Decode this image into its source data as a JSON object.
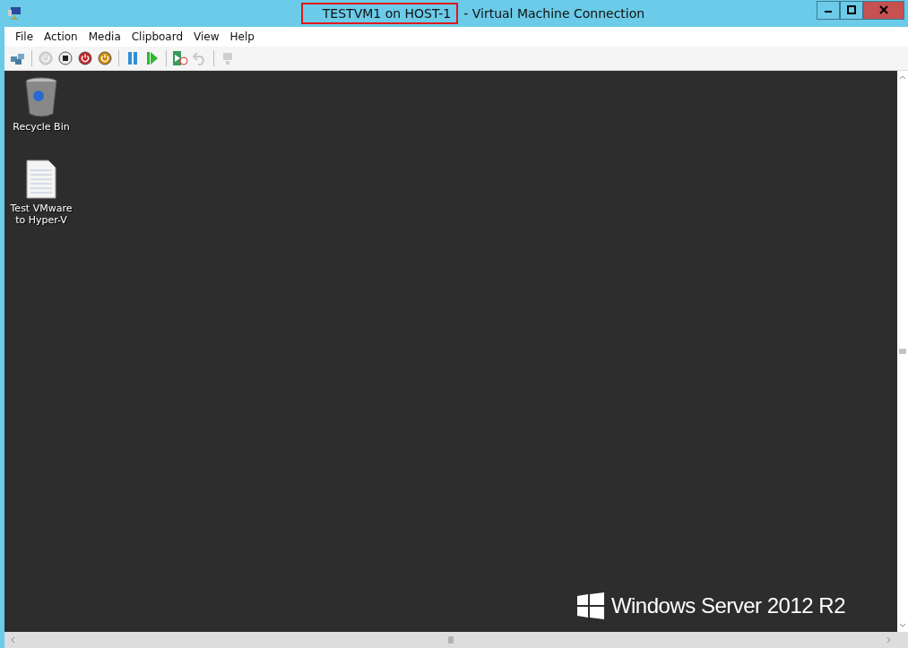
{
  "window": {
    "title_highlighted": "TESTVM1 on HOST-1",
    "title_rest": "- Virtual Machine Connection"
  },
  "menu": [
    "File",
    "Action",
    "Media",
    "Clipboard",
    "View",
    "Help"
  ],
  "toolbar": [
    [
      {
        "kind": "ctrl-alt-del",
        "disabled": false
      }
    ],
    [
      {
        "kind": "start",
        "disabled": true
      },
      {
        "kind": "turn-off",
        "disabled": false
      },
      {
        "kind": "shutdown",
        "disabled": false
      },
      {
        "kind": "save",
        "disabled": false
      }
    ],
    [
      {
        "kind": "pause",
        "disabled": false
      },
      {
        "kind": "resume",
        "disabled": false
      }
    ],
    [
      {
        "kind": "checkpoint",
        "disabled": false
      },
      {
        "kind": "revert",
        "disabled": true
      }
    ],
    [
      {
        "kind": "share",
        "disabled": true
      }
    ]
  ],
  "desktop": {
    "icons": [
      {
        "kind": "recycle-bin",
        "label": "Recycle Bin"
      },
      {
        "kind": "text-file",
        "label": "Test VMware to Hyper-V"
      }
    ],
    "brand": "Windows Server 2012 R2"
  }
}
